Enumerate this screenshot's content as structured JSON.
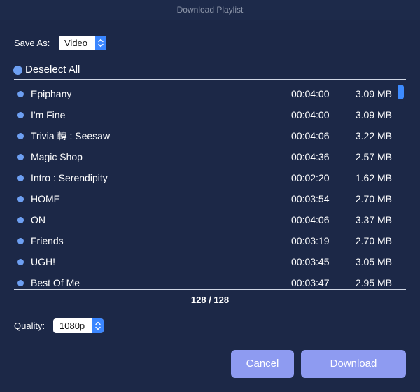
{
  "window": {
    "title": "Download Playlist"
  },
  "save_as": {
    "label": "Save As:",
    "selected": "Video"
  },
  "deselect_all": {
    "label": "Deselect All"
  },
  "tracks": [
    {
      "name": "Epiphany",
      "duration": "00:04:00",
      "size": "3.09 MB"
    },
    {
      "name": "I'm Fine",
      "duration": "00:04:00",
      "size": "3.09 MB"
    },
    {
      "name": "Trivia 轉 : Seesaw",
      "duration": "00:04:06",
      "size": "3.22 MB"
    },
    {
      "name": "Magic Shop",
      "duration": "00:04:36",
      "size": "2.57 MB"
    },
    {
      "name": "Intro : Serendipity",
      "duration": "00:02:20",
      "size": "1.62 MB"
    },
    {
      "name": "HOME",
      "duration": "00:03:54",
      "size": "2.70 MB"
    },
    {
      "name": "ON",
      "duration": "00:04:06",
      "size": "3.37 MB"
    },
    {
      "name": "Friends",
      "duration": "00:03:19",
      "size": "2.70 MB"
    },
    {
      "name": "UGH!",
      "duration": "00:03:45",
      "size": "3.05 MB"
    },
    {
      "name": "Best Of Me",
      "duration": "00:03:47",
      "size": "2.95 MB"
    }
  ],
  "selection_count": "128 / 128",
  "quality": {
    "label": "Quality:",
    "selected": "1080p"
  },
  "buttons": {
    "cancel": "Cancel",
    "download": "Download"
  },
  "colors": {
    "background": "#1c2847",
    "accent": "#3a86ff",
    "dot": "#6d9ff2",
    "button": "#8e9bf1"
  }
}
